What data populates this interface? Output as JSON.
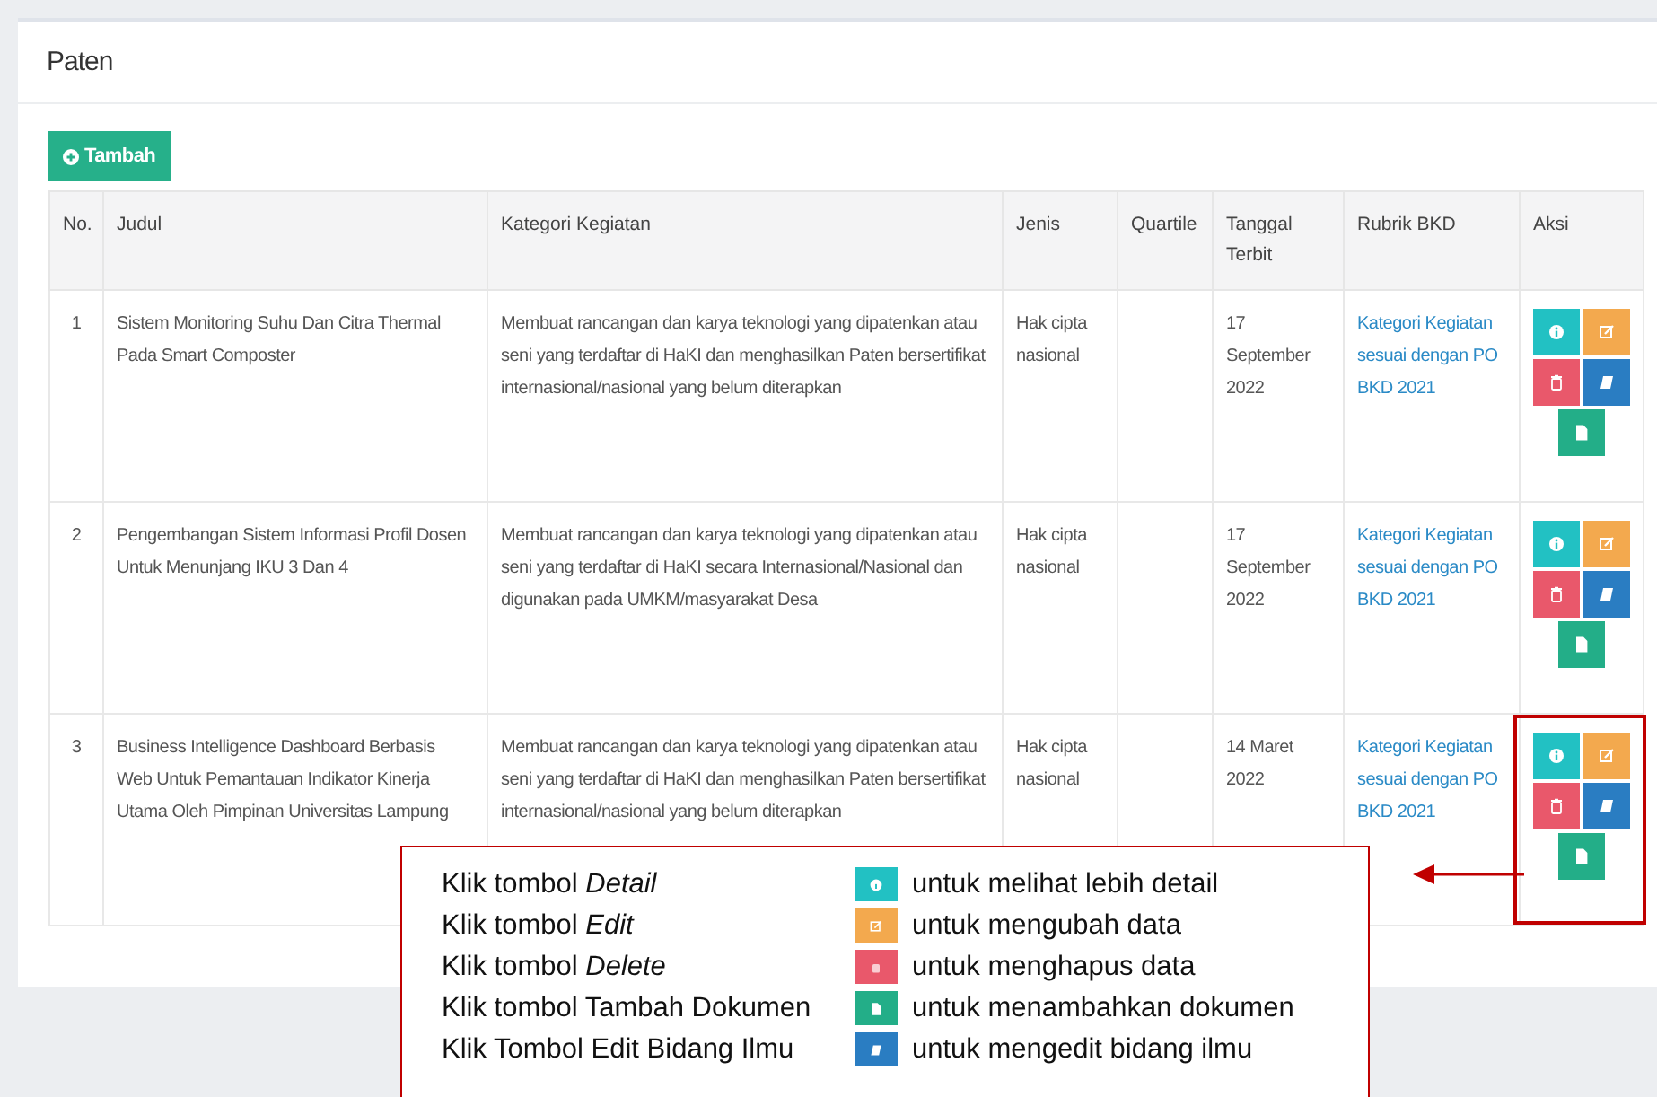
{
  "panel": {
    "title": "Paten",
    "add_button": "Tambah"
  },
  "table": {
    "columns": [
      "No.",
      "Judul",
      "Kategori Kegiatan",
      "Jenis",
      "Quartile",
      "Tanggal Terbit",
      "Rubrik BKD",
      "Aksi"
    ],
    "rows": [
      {
        "no": "1",
        "judul": "Sistem Monitoring Suhu Dan Citra Thermal Pada Smart Composter",
        "kategori": "Membuat rancangan dan karya teknologi yang dipatenkan atau seni yang terdaftar di HaKI dan menghasilkan Paten bersertifikat internasional/nasional yang belum diterapkan",
        "jenis": "Hak cipta nasional",
        "tanggal": "17 September 2022",
        "rubrik": "Kategori Kegiatan sesuai dengan PO BKD 2021",
        "highlighted": false,
        "actions": [
          {
            "kind": "info"
          },
          {
            "kind": "edit"
          },
          {
            "kind": "delete"
          },
          {
            "kind": "book"
          },
          {
            "kind": "doc"
          }
        ]
      },
      {
        "no": "2",
        "judul": "Pengembangan Sistem Informasi Profil Dosen Untuk Menunjang IKU 3 Dan 4",
        "kategori": "Membuat rancangan dan karya teknologi yang dipatenkan atau seni yang terdaftar di HaKI secara Internasional/Nasional dan digunakan pada UMKM/masyarakat Desa",
        "jenis": "Hak cipta nasional",
        "tanggal": "17 September 2022",
        "rubrik": "Kategori Kegiatan sesuai dengan PO BKD 2021",
        "highlighted": false,
        "actions": [
          {
            "kind": "info"
          },
          {
            "kind": "edit"
          },
          {
            "kind": "delete"
          },
          {
            "kind": "book"
          },
          {
            "kind": "doc"
          }
        ]
      },
      {
        "no": "3",
        "judul": "Business Intelligence Dashboard Berbasis Web Untuk Pemantauan Indikator Kinerja Utama Oleh Pimpinan Universitas Lampung",
        "kategori": "Membuat rancangan dan karya teknologi yang dipatenkan atau seni yang terdaftar di HaKI dan menghasilkan Paten bersertifikat internasional/nasional yang belum diterapkan",
        "jenis": "Hak cipta nasional",
        "tanggal": "14 Maret 2022",
        "rubrik": "Kategori Kegiatan sesuai dengan PO BKD 2021",
        "highlighted": true,
        "actions": [
          {
            "kind": "info"
          },
          {
            "kind": "edit"
          },
          {
            "kind": "delete"
          },
          {
            "kind": "book"
          },
          {
            "kind": "doc"
          }
        ]
      }
    ]
  },
  "legend": [
    {
      "label": "Klik tombol *Detail*",
      "kind": "info",
      "text": "untuk melihat lebih detail"
    },
    {
      "label": "Klik tombol *Edit*",
      "kind": "edit",
      "text": "untuk mengubah data"
    },
    {
      "label": "Klik tombol *Delete*",
      "kind": "delete",
      "text": "untuk menghapus data"
    },
    {
      "label": "Klik tombol Tambah Dokumen",
      "kind": "doc",
      "text": "untuk menambahkan dokumen"
    },
    {
      "label": "Klik Tombol Edit Bidang Ilmu",
      "kind": "book",
      "text": "untuk mengedit bidang ilmu"
    }
  ]
}
